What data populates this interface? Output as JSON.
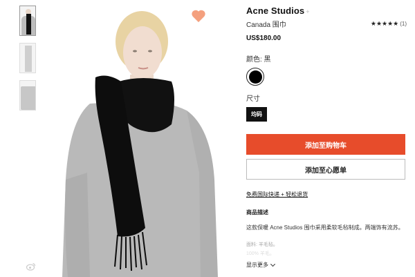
{
  "product": {
    "brand": "Acne Studios",
    "brand_suffix": "+",
    "name": "Canada 围巾",
    "rating_stars": "★★★★★",
    "rating_count": "(1)",
    "price": "US$180.00",
    "color_label": "颜色: 黑",
    "selected_color": "#000000",
    "size_label": "尺寸",
    "size_option": "均码"
  },
  "actions": {
    "add_to_cart": "添加至购物车",
    "add_to_wishlist": "添加至心愿单",
    "shipping_link": "免费国际快递 + 轻松退货",
    "show_more": "显示更多"
  },
  "description": {
    "title": "商品描述",
    "text": "这款保暖 Acne Studios 围巾采用柔软毛毡制成。两端饰有流苏。",
    "material": "面料: 羊毛毡。",
    "material_extra": "100% 羊毛。"
  },
  "colors": {
    "accent": "#e74c2b",
    "heart": "#f4a07e"
  },
  "icons": {
    "favorite": "heart-icon",
    "share": "weibo-icon",
    "expand": "chevron-down-icon"
  }
}
